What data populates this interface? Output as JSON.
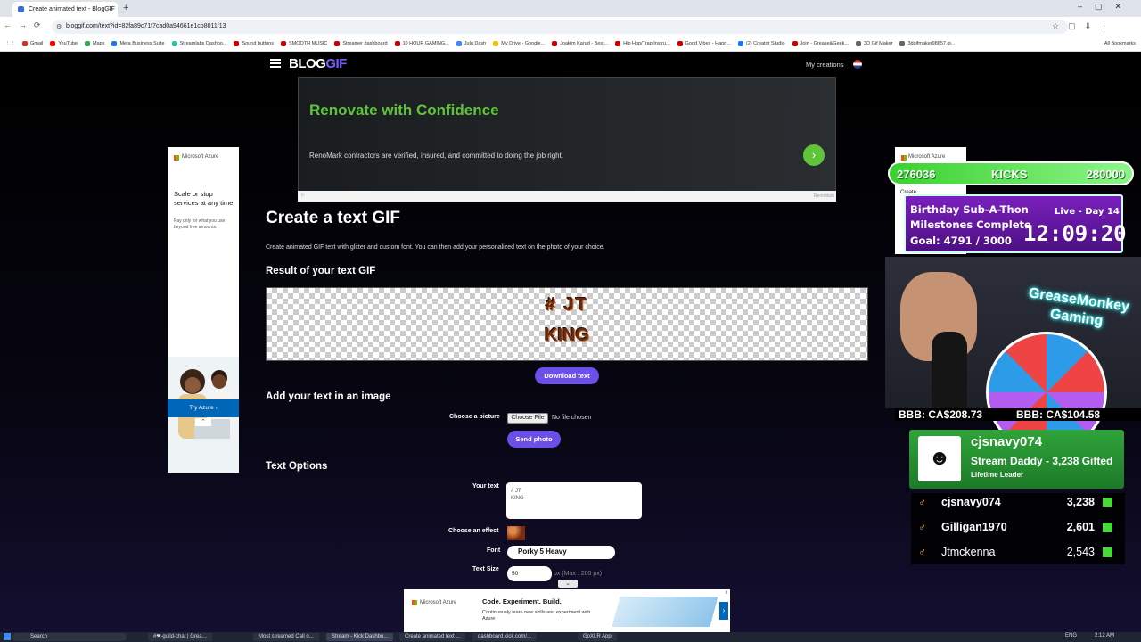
{
  "browser": {
    "tab_title": "Create animated text - BlogGIF",
    "url": "bloggif.com/text?id=82fa89c71f7cad0a94661e1cb8011f13",
    "bookmarks": [
      {
        "label": "Gmail",
        "color": "#d93025"
      },
      {
        "label": "YouTube",
        "color": "#ff0000"
      },
      {
        "label": "Maps",
        "color": "#34a853"
      },
      {
        "label": "Meta Business Suite",
        "color": "#1877f2"
      },
      {
        "label": "Streamlabs Dashbo...",
        "color": "#31c3a2"
      },
      {
        "label": "Sound buttons",
        "color": "#cc0000"
      },
      {
        "label": "SMOOTH MUSIC",
        "color": "#cc0000"
      },
      {
        "label": "Streamer dashboard",
        "color": "#cc0000"
      },
      {
        "label": "10 HOUR GAMING...",
        "color": "#cc0000"
      },
      {
        "label": "Julu Dash",
        "color": "#4285f4"
      },
      {
        "label": "My Drive - Google...",
        "color": "#fbbc04"
      },
      {
        "label": "Joakim Karud - Best...",
        "color": "#cc0000"
      },
      {
        "label": "Hip Hop/Trap Instru...",
        "color": "#cc0000"
      },
      {
        "label": "Good Vibes - Happ...",
        "color": "#cc0000"
      },
      {
        "label": "(2) Creator Studio",
        "color": "#1877f2"
      },
      {
        "label": "Join - Grease&Geek...",
        "color": "#cc0000"
      },
      {
        "label": "3D Gif Maker",
        "color": "#666666"
      },
      {
        "label": "3dgifmaker98657.gi...",
        "color": "#666666"
      }
    ],
    "all_bookmarks": "All Bookmarks"
  },
  "site": {
    "logo": {
      "part1": "BLOG",
      "part2": "GIF"
    },
    "my_creations": "My creations"
  },
  "top_ad": {
    "title": "Renovate with Confidence",
    "text": "RenoMark contractors are verified, insured, and committed to doing the job right.",
    "next_glyph": "›",
    "footer": "RenoMark"
  },
  "page": {
    "title": "Create a text GIF",
    "description": "Create animated GIF text with glitter and custom font. You can then add your personalized text on the photo of your choice.",
    "result_heading": "Result of your text GIF",
    "gif_line1": "# JT",
    "gif_line2": "KING",
    "download_button": "Download text",
    "add_heading": "Add your text in an image",
    "choose_picture_label": "Choose a picture",
    "choose_file_button": "Choose File",
    "no_file": "No file chosen",
    "send_button": "Send photo",
    "options_heading": "Text Options",
    "your_text_label": "Your text",
    "your_text_line1": "# JT",
    "your_text_line2": "KING",
    "effect_label": "Choose an effect",
    "font_label": "Font",
    "font_value": "Porky 5 Heavy",
    "size_label": "Text Size",
    "size_value": "50",
    "size_hint": "px (Max : 200 px)"
  },
  "left_ad": {
    "brand": "Microsoft Azure",
    "headline": "Scale or stop services at any time",
    "sub": "Pay only for what you use beyond free amounts.",
    "cta": "Try Azure ›"
  },
  "bottom_ad": {
    "brand": "Microsoft Azure",
    "headline": "Code. Experiment. Build.",
    "sub": "Continuously learn new skills and experiment with Azure",
    "next": "›",
    "close": "x"
  },
  "right_ad": {
    "brand": "Microsoft Azure",
    "create": "Create"
  },
  "overlay": {
    "kicks_current": "276036",
    "kicks_label": "KICKS",
    "kicks_goal": "280000",
    "subathon_title": "Birthday Sub-A-Thon",
    "subathon_day": "Live - Day 14",
    "subathon_milestones": "Milestones Complete",
    "subathon_goal": "Goal: 4791 / 3000",
    "timer": "12:09:20",
    "cam_title": "GreaseMonkey Gaming",
    "bbb_left": "BBB: CA$208.73",
    "bbb_right": "BBB: CA$104.58",
    "leader_name": "cjsnavy074",
    "leader_detail": "Stream Daddy - 3,238 Gifted",
    "leader_tag": "Lifetime Leader",
    "leaders": [
      {
        "name": "cjsnavy074",
        "amount": "3,238"
      },
      {
        "name": "Gilligan1970",
        "amount": "2,601"
      },
      {
        "name": "Jtmckenna",
        "amount": "2,543"
      }
    ]
  },
  "taskbar": {
    "search": "Search",
    "items": [
      "#❤-guild-chat | Grea...",
      "Most streamed Call o...",
      "Stream - Kick Dashbo...",
      "Create animated text ...",
      "dashboard.kick.com/...",
      "GoXLR App"
    ],
    "lang": "ENG",
    "time": "2:12 AM"
  }
}
